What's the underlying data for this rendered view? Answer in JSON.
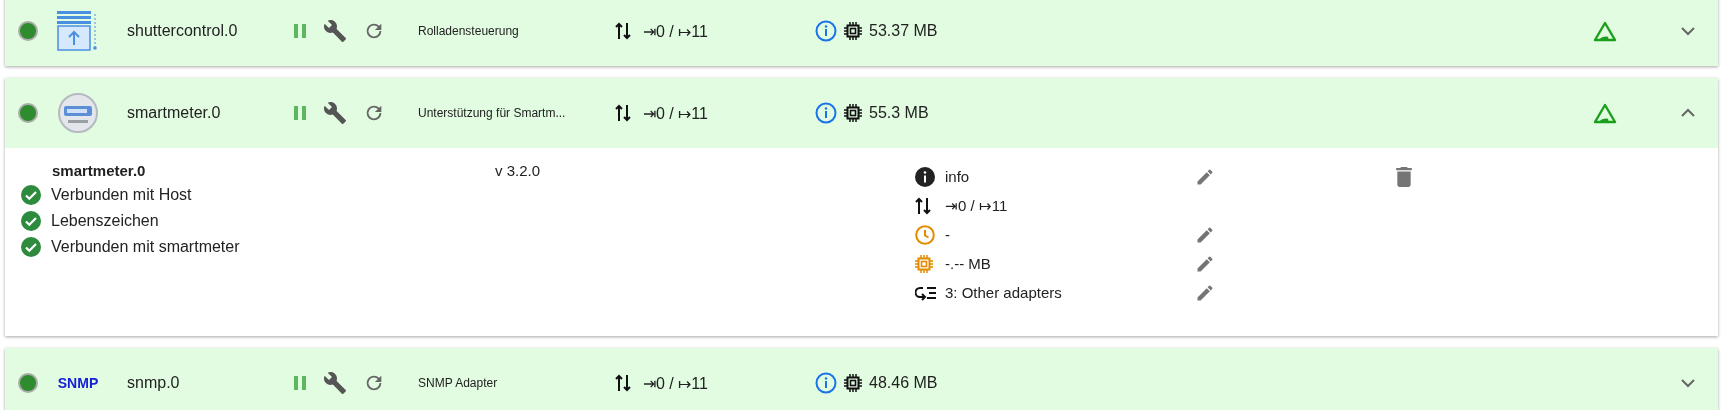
{
  "adapters": [
    {
      "icon": {
        "kind": "blinds"
      },
      "name": "shuttercontrol.0",
      "running": true,
      "title": "Rolladensteuerung",
      "events": "⇥0 / ↦11",
      "memory": "53.37 MB",
      "connected": true,
      "expanded": false
    },
    {
      "icon": {
        "kind": "meter"
      },
      "name": "smartmeter.0",
      "running": true,
      "title": "Unterstützung für Smartm...",
      "events": "⇥0 / ↦11",
      "memory": "55.3 MB",
      "connected": true,
      "expanded": true,
      "details": {
        "title": "smartmeter.0",
        "version": "v 3.2.0",
        "deletable": true,
        "checks": [
          {
            "label": "Verbunden mit Host",
            "ok": true
          },
          {
            "label": "Lebenszeichen",
            "ok": true
          },
          {
            "label": "Verbunden mit smartmeter",
            "ok": true
          }
        ],
        "properties": [
          {
            "kind": "info",
            "value": "info",
            "editable": true
          },
          {
            "kind": "events",
            "value": "⇥0 / ↦11",
            "editable": false
          },
          {
            "kind": "schedule",
            "value": "-",
            "editable": true
          },
          {
            "kind": "memory",
            "value": "-.-- MB",
            "editable": true
          },
          {
            "kind": "group",
            "value": "3: Other adapters",
            "editable": true
          }
        ]
      }
    },
    {
      "icon": {
        "kind": "text",
        "label": "SNMP"
      },
      "name": "snmp.0",
      "running": true,
      "title": "SNMP Adapter",
      "events": "⇥0 / ↦11",
      "memory": "48.46 MB",
      "expanded": false
    }
  ]
}
